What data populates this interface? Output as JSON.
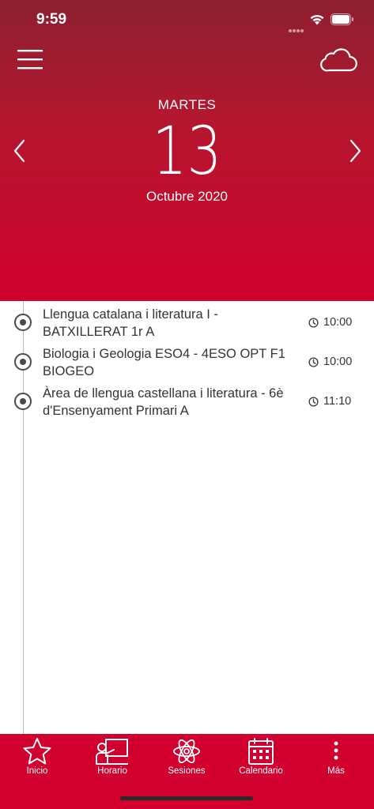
{
  "status_bar": {
    "time": "9:59"
  },
  "header": {
    "weekday": "MARTES",
    "day": "13",
    "month_year": "Octubre 2020"
  },
  "sessions": [
    {
      "title": "Llengua catalana i literatura I - BATXILLERAT 1r A",
      "time": "10:00"
    },
    {
      "title": "Biologia i Geologia ESO4 - 4ESO OPT F1 BIOGEO",
      "time": "10:00"
    },
    {
      "title": "Àrea de llengua castellana i literatura - 6è d'Ensenyament Primari A",
      "time": "11:10"
    }
  ],
  "tabs": [
    {
      "label": "Inicio",
      "icon": "star-icon"
    },
    {
      "label": "Horario",
      "icon": "teacher-board-icon"
    },
    {
      "label": "Sesiones",
      "icon": "atom-icon"
    },
    {
      "label": "Calendario",
      "icon": "calendar-icon"
    },
    {
      "label": "Más",
      "icon": "more-vertical-icon"
    }
  ],
  "colors": {
    "header_top": "#8c1f30",
    "header_bottom": "#d1002f",
    "tabbar": "#d1002f",
    "text": "#333333"
  }
}
